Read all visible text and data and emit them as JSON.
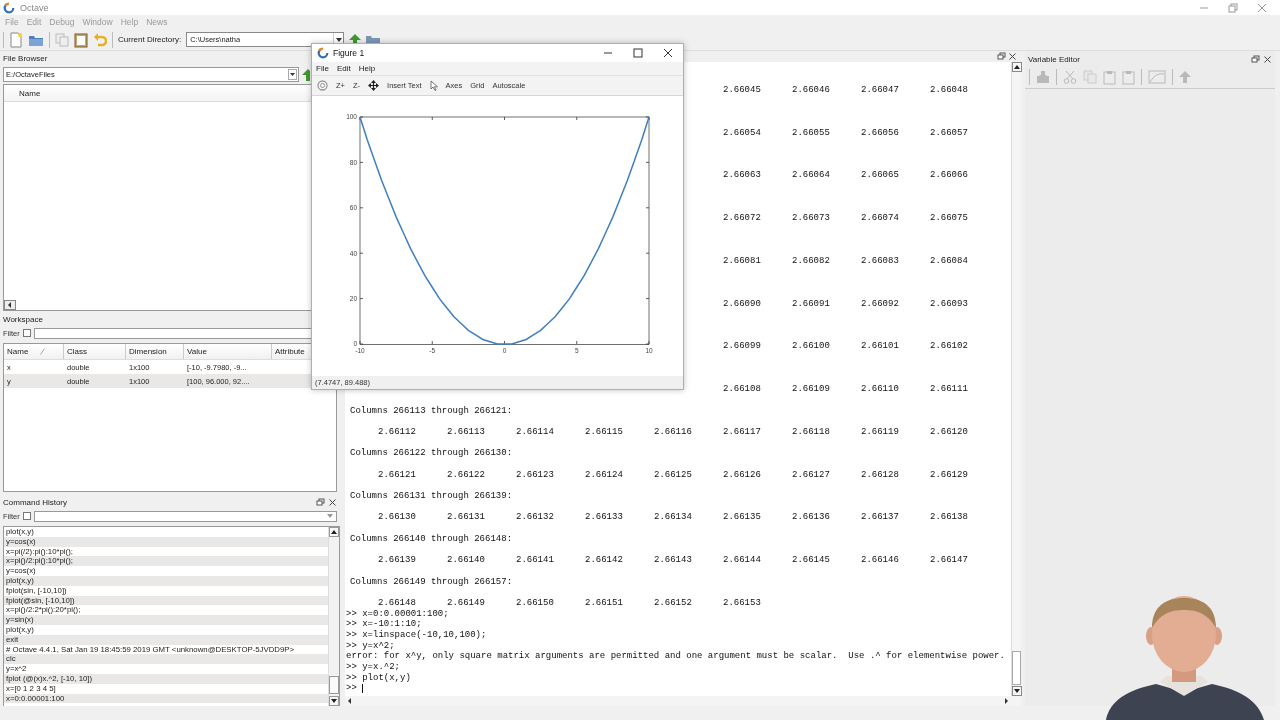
{
  "window": {
    "title": "Octave",
    "menu": [
      "File",
      "Edit",
      "Debug",
      "Window",
      "Help",
      "News"
    ]
  },
  "toolbar": {
    "current_directory_label": "Current Directory:",
    "current_directory": "C:\\Users\\natha"
  },
  "file_browser": {
    "title": "File Browser",
    "path": "E:/OctaveFiles",
    "columns": [
      "Name"
    ]
  },
  "workspace": {
    "title": "Workspace",
    "filter_label": "Filter",
    "filter_checked": false,
    "columns": [
      {
        "label": "Name",
        "sorted": true
      },
      {
        "label": "Class",
        "sorted": false
      },
      {
        "label": "Dimension",
        "sorted": false
      },
      {
        "label": "Value",
        "sorted": false
      },
      {
        "label": "Attribute",
        "sorted": false
      }
    ],
    "rows": [
      [
        "x",
        "double",
        "1x100",
        "[-10, -9.7980, -9..."
      ],
      [
        "y",
        "double",
        "1x100",
        "[100, 96.000, 92...."
      ]
    ]
  },
  "command_history": {
    "title": "Command History",
    "filter_label": "Filter",
    "filter_checked": false,
    "entries": [
      "plot(x,y)",
      "y=cos(x)",
      "x=pi(/2):pi():10*pi();",
      "x=pi()/2:pi():10*pi();",
      "y=cos(x)",
      "plot(x,y)",
      "fplot(sin, [-10,10])",
      "fplot(@sin, [-10,10])",
      "x=pi()/2:2*pi():20*pi();",
      "y=sin(x)",
      "plot(x,y)",
      "exit",
      "# Octave 4.4.1, Sat Jan 19 18:45:59 2019 GMT <unknown@DESKTOP-5JVDD9P>",
      "clc",
      "y=x^2",
      "fplot (@(x)x.^2, [-10, 10])",
      "x=[0 1 2 3 4 5]",
      "x=0:0.00001:100"
    ]
  },
  "command_window": {
    "blocks": [
      {
        "values": [
          "2.66045",
          "2.66046",
          "2.66047",
          "2.66048"
        ]
      },
      {
        "values": [
          "2.66054",
          "2.66055",
          "2.66056",
          "2.66057"
        ]
      },
      {
        "values": [
          "2.66063",
          "2.66064",
          "2.66065",
          "2.66066"
        ]
      },
      {
        "values": [
          "2.66072",
          "2.66073",
          "2.66074",
          "2.66075"
        ]
      },
      {
        "values": [
          "2.66081",
          "2.66082",
          "2.66083",
          "2.66084"
        ]
      },
      {
        "values": [
          "2.66090",
          "2.66091",
          "2.66092",
          "2.66093"
        ]
      },
      {
        "values": [
          "2.66099",
          "2.66100",
          "2.66101",
          "2.66102"
        ]
      },
      {
        "values": [
          "2.66108",
          "2.66109",
          "2.66110",
          "2.66111"
        ]
      },
      {
        "header": "Columns 266113 through 266121:",
        "values": [
          "2.66112",
          "2.66113",
          "2.66114",
          "2.66115",
          "2.66116",
          "2.66117",
          "2.66118",
          "2.66119",
          "2.66120"
        ]
      },
      {
        "header": "Columns 266122 through 266130:",
        "values": [
          "2.66121",
          "2.66122",
          "2.66123",
          "2.66124",
          "2.66125",
          "2.66126",
          "2.66127",
          "2.66128",
          "2.66129"
        ]
      },
      {
        "header": "Columns 266131 through 266139:",
        "values": [
          "2.66130",
          "2.66131",
          "2.66132",
          "2.66133",
          "2.66134",
          "2.66135",
          "2.66136",
          "2.66137",
          "2.66138"
        ]
      },
      {
        "header": "Columns 266140 through 266148:",
        "values": [
          "2.66139",
          "2.66140",
          "2.66141",
          "2.66142",
          "2.66143",
          "2.66144",
          "2.66145",
          "2.66146",
          "2.66147"
        ]
      },
      {
        "header": "Columns 266149 through 266157:",
        "values": [
          "2.66148",
          "2.66149",
          "2.66150",
          "2.66151",
          "2.66152",
          "2.66153"
        ]
      }
    ],
    "lines": [
      {
        "kind": "command",
        "text": ">> x=0:0.00001:100;"
      },
      {
        "kind": "command",
        "text": ">> x=-10:1:10;"
      },
      {
        "kind": "command",
        "text": ">> x=linspace(-10,10,100);"
      },
      {
        "kind": "command",
        "text": ">> y=x^2;"
      },
      {
        "kind": "error",
        "text": "error: for x^y, only square matrix arguments are permitted and one argument must be scalar.  Use .^ for elementwise power."
      },
      {
        "kind": "command",
        "text": ">> y=x.^2;"
      },
      {
        "kind": "command",
        "text": ">> plot(x,y)"
      },
      {
        "kind": "prompt",
        "text": ">>"
      }
    ]
  },
  "variable_editor": {
    "title": "Variable Editor"
  },
  "figure": {
    "title": "Figure 1",
    "menu": [
      "File",
      "Edit",
      "Help"
    ],
    "tools": [
      {
        "kind": "rotate"
      },
      {
        "kind": "text",
        "label": "Z+"
      },
      {
        "kind": "text",
        "label": "Z-"
      },
      {
        "kind": "pan"
      },
      {
        "kind": "text",
        "label": "Insert Text"
      },
      {
        "kind": "select"
      },
      {
        "kind": "text",
        "label": "Axes"
      },
      {
        "kind": "text",
        "label": "Grid"
      },
      {
        "kind": "text",
        "label": "Autoscale"
      }
    ],
    "chart_data": {
      "type": "line",
      "x": [
        -10,
        -9.5,
        -9,
        -8.5,
        -8,
        -7.5,
        -7,
        -6.5,
        -6,
        -5.5,
        -5,
        -4.5,
        -4,
        -3.5,
        -3,
        -2.5,
        -2,
        -1.5,
        -1,
        -0.5,
        0,
        0.5,
        1,
        1.5,
        2,
        2.5,
        3,
        3.5,
        4,
        4.5,
        5,
        5.5,
        6,
        6.5,
        7,
        7.5,
        8,
        8.5,
        9,
        9.5,
        10
      ],
      "series": [
        {
          "color": "#3f7fbf",
          "values": [
            100,
            90,
            81,
            72,
            64,
            56,
            49,
            42,
            36,
            30,
            25,
            20,
            16,
            12,
            9,
            6,
            4,
            2,
            1,
            0,
            0,
            0,
            1,
            2,
            4,
            6,
            9,
            12,
            16,
            20,
            25,
            30,
            36,
            42,
            49,
            56,
            64,
            72,
            81,
            90,
            100
          ]
        }
      ],
      "xlim": [
        -10,
        10
      ],
      "ylim": [
        0,
        100
      ],
      "xticks": [
        -10,
        -5,
        0,
        5,
        10
      ],
      "yticks": [
        0,
        20,
        40,
        60,
        80,
        100
      ]
    },
    "status": "(7.4747, 89.488)"
  }
}
